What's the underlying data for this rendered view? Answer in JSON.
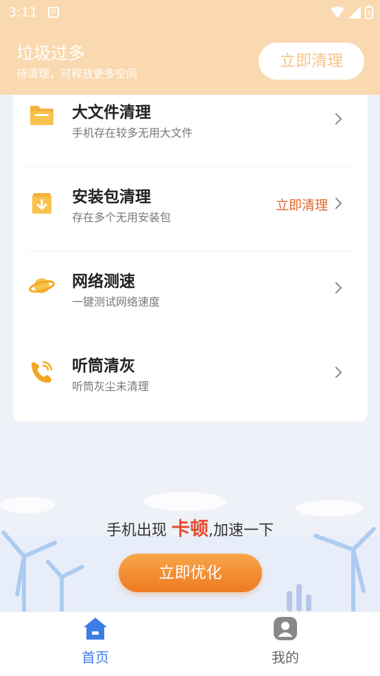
{
  "status_bar": {
    "time": "3:11",
    "notif_glyph": "A"
  },
  "header": {
    "title": "垃圾过多",
    "subtitle": "待清理，可释放更多空间",
    "button_label": "立即清理"
  },
  "items": [
    {
      "title": "大文件清理",
      "subtitle": "手机存在较多无用大文件",
      "action": "",
      "icon": "folder-icon"
    },
    {
      "title": "安装包清理",
      "subtitle": "存在多个无用安装包",
      "action": "立即清理",
      "icon": "package-download-icon"
    },
    {
      "title": "网络测速",
      "subtitle": "一键测试网络速度",
      "action": "",
      "icon": "planet-icon"
    },
    {
      "title": "听筒清灰",
      "subtitle": "听筒灰尘未清理",
      "action": "",
      "icon": "phone-receiver-icon"
    }
  ],
  "promo": {
    "text_before": "手机出现 ",
    "highlight": "卡顿",
    "text_after": ",加速一下",
    "button_label": "立即优化"
  },
  "nav": {
    "home_label": "首页",
    "me_label": "我的"
  },
  "colors": {
    "accent": "#ef7a23",
    "header_bg": "#fad9b0",
    "nav_active": "#3d7de8",
    "action_text": "#e0662a"
  }
}
